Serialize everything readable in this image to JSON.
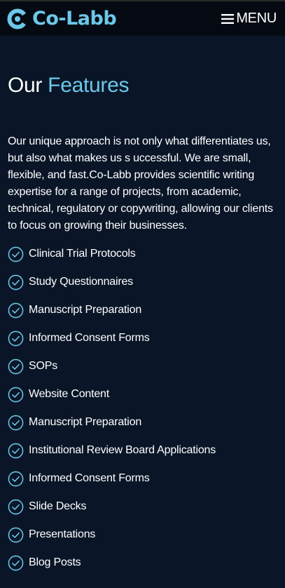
{
  "header": {
    "logo_text": "Co-Labb",
    "menu_label": "MENU",
    "logo_icon": "c-logo-icon",
    "menu_icon": "hamburger-icon"
  },
  "main": {
    "title_plain": "Our",
    "title_accent": "Features",
    "description": "Our unique approach is not only what differentiates us, but also what makes us s uccessful. We are small, flexible, and fast.Co-Labb provides scientific writing expertise for a range of projects, from academic, technical, regulatory or copywriting, allowing our clients to focus on growing their businesses.",
    "feature_icon": "check-circle-icon",
    "features": [
      "Clinical Trial Protocols",
      "Study Questionnaires",
      "Manuscript Preparation",
      "Informed Consent Forms",
      "SOPs",
      "Website Content",
      "Manuscript Preparation",
      "Institutional Review Board Applications",
      "Informed Consent Forms",
      "Slide Decks",
      "Presentations",
      "Blog Posts"
    ]
  },
  "colors": {
    "background": "#0a1628",
    "header_background": "#050a12",
    "accent": "#6cc8e8",
    "text": "#ffffff"
  }
}
